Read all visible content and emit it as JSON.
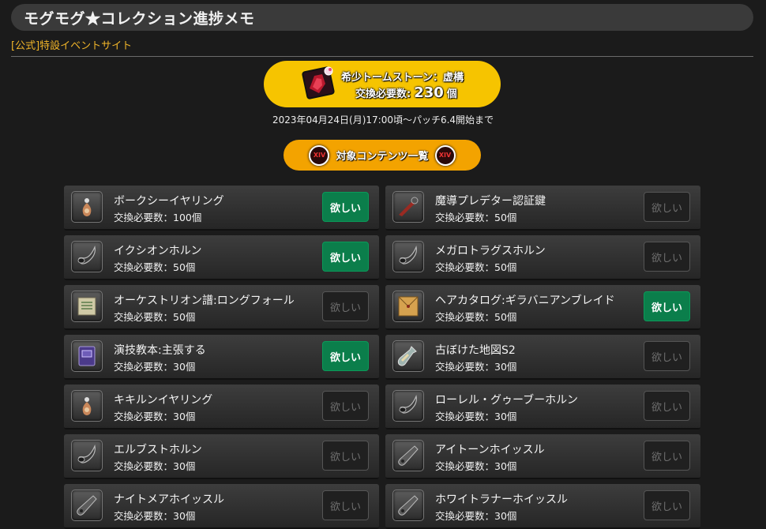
{
  "header": {
    "title": "モグモグ★コレクション進捗メモ"
  },
  "official_link": "[公式]特設イベントサイト",
  "tome": {
    "name": "希少トームストーン：虚構",
    "cost_label": "交換必要数:",
    "cost_value": "230",
    "cost_unit": "個",
    "icon": "tomestone-icon"
  },
  "deadline": "2023年04月24日(月)17:00頃～パッチ6.4開始まで",
  "content_button": {
    "label": "対象コンテンツ一覧",
    "badge": "XIV"
  },
  "want_label": "欲しい",
  "items": [
    {
      "name": "ボークシーイヤリング",
      "cost": "交換必要数：100個",
      "wanted": true,
      "icon": "earring-icon"
    },
    {
      "name": "魔導プレデター認証鍵",
      "cost": "交換必要数：50個",
      "wanted": false,
      "icon": "key-icon"
    },
    {
      "name": "イクシオンホルン",
      "cost": "交換必要数：50個",
      "wanted": true,
      "icon": "horn-icon"
    },
    {
      "name": "メガロトラグスホルン",
      "cost": "交換必要数：50個",
      "wanted": false,
      "icon": "horn-icon"
    },
    {
      "name": "オーケストリオン譜:ロングフォール",
      "cost": "交換必要数：50個",
      "wanted": false,
      "icon": "scroll-icon"
    },
    {
      "name": "ヘアカタログ:ギラバニアンブレイド",
      "cost": "交換必要数：50個",
      "wanted": true,
      "icon": "envelope-icon"
    },
    {
      "name": "演技教本:主張する",
      "cost": "交換必要数：30個",
      "wanted": true,
      "icon": "book-icon"
    },
    {
      "name": "古ぼけた地図S2",
      "cost": "交換必要数：30個",
      "wanted": false,
      "icon": "bottle-icon"
    },
    {
      "name": "キキルンイヤリング",
      "cost": "交換必要数：30個",
      "wanted": false,
      "icon": "earring-icon"
    },
    {
      "name": "ローレル・グゥーブーホルン",
      "cost": "交換必要数：30個",
      "wanted": false,
      "icon": "horn-icon"
    },
    {
      "name": "エルブストホルン",
      "cost": "交換必要数：30個",
      "wanted": false,
      "icon": "horn-icon"
    },
    {
      "name": "アイトーンホイッスル",
      "cost": "交換必要数：30個",
      "wanted": false,
      "icon": "whistle-icon"
    },
    {
      "name": "ナイトメアホイッスル",
      "cost": "交換必要数：30個",
      "wanted": false,
      "icon": "whistle-icon"
    },
    {
      "name": "ホワイトラナーホイッスル",
      "cost": "交換必要数：30個",
      "wanted": false,
      "icon": "whistle-icon"
    }
  ],
  "colors": {
    "accent_yellow": "#f6c400",
    "accent_orange": "#f3a300",
    "want_on": "#0b7e4b",
    "link": "#f0b429"
  }
}
